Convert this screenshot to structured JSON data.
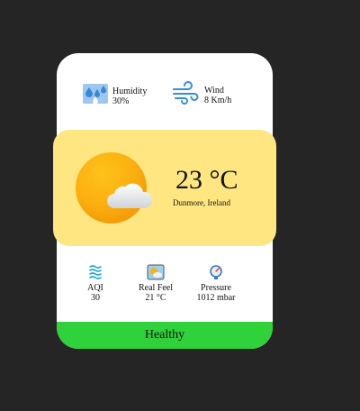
{
  "stats": {
    "humidity": {
      "label": "Humidity",
      "value": "30%",
      "icon": "humidity-icon"
    },
    "wind": {
      "label": "Wind",
      "value": "8 Km/h",
      "icon": "wind-icon"
    }
  },
  "weather": {
    "temperature": "23 °C",
    "location": "Dunmore, Ireland",
    "icon": "partly-cloudy-icon"
  },
  "metrics": [
    {
      "label": "AQI",
      "value": "30",
      "icon": "aqi-icon"
    },
    {
      "label": "Real Feel",
      "value": "21 °C",
      "icon": "real-feel-icon"
    },
    {
      "label": "Pressure",
      "value": "1012 mbar",
      "icon": "pressure-icon"
    }
  ],
  "status": {
    "label": "Healthy",
    "color": "#2fd23a"
  },
  "colors": {
    "background": "#252525",
    "card": "#ffffff",
    "hero": "#ffe681",
    "sun": "#fbb010"
  }
}
